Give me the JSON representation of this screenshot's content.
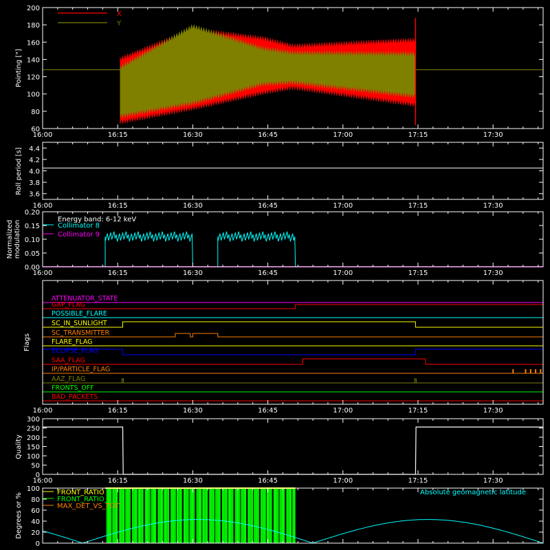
{
  "colors": {
    "background": "#000000",
    "axes": "#ffffff",
    "x": "#ff0000",
    "y": "#808000",
    "coll8": "#00ffff",
    "coll9": "#ff00ff",
    "flags": [
      "#ff00ff",
      "#ff0000",
      "#00ffff",
      "#ffff00",
      "#ff8000",
      "#ffff00",
      "#0000ff",
      "#ff0000",
      "#ff8000",
      "#808000",
      "#00ff00",
      "#ff0000"
    ],
    "front_ratio": "#ffff00",
    "front_ratio_2": "#00ff00",
    "max_det": "#ff8000",
    "geomag": "#00ffff"
  },
  "time_ticks": [
    "16:00",
    "16:15",
    "16:30",
    "16:45",
    "17:00",
    "17:15",
    "17:30"
  ],
  "chart_data": [
    {
      "id": "pointing",
      "type": "line",
      "ylabel": "Pointing [\"]",
      "ylim": [
        60,
        200
      ],
      "yticks": [
        "200",
        "180",
        "160",
        "140",
        "120",
        "100",
        "80",
        "60"
      ],
      "yvals": [
        200,
        180,
        160,
        140,
        120,
        100,
        80,
        60
      ],
      "legend": [
        "X",
        "Y"
      ],
      "x_range": [
        "16:00",
        "17:40"
      ],
      "series": [
        {
          "name": "X",
          "envelope_time": [
            "16:15.5",
            "16:30",
            "16:44",
            "16:50",
            "17:14.5"
          ],
          "upper": [
            140,
            174,
            164,
            155,
            162
          ],
          "lower": [
            68,
            84,
            102,
            108,
            88
          ]
        },
        {
          "name": "Y",
          "envelope_time": [
            "16:15.5",
            "16:30",
            "16:44",
            "16:50",
            "17:14.5"
          ],
          "upper": [
            130,
            178,
            152,
            147,
            146
          ],
          "lower": [
            75,
            90,
            112,
            114,
            98
          ]
        }
      ],
      "baseline": 128
    },
    {
      "id": "roll",
      "type": "line",
      "ylabel": "Roll period [s]",
      "ylim": [
        3.5,
        4.5
      ],
      "yticks": [
        "4.4",
        "4.2",
        "4.0",
        "3.8",
        "3.6"
      ],
      "yvals": [
        4.4,
        4.2,
        4.0,
        3.8,
        3.6
      ],
      "series": [
        {
          "value": 4.05
        }
      ]
    },
    {
      "id": "modulation",
      "type": "line",
      "ylabel_lines": [
        "Normalized",
        "modulation"
      ],
      "ylim": [
        0,
        0.2
      ],
      "yticks": [
        "0.20",
        "0.15",
        "0.10",
        "0.05",
        "0.00"
      ],
      "yvals": [
        0.2,
        0.15,
        0.1,
        0.05,
        0.0
      ],
      "legend_title": "Energy band: 6-12 keV",
      "legend": [
        "Collimator 8",
        "Collimator 9"
      ],
      "segments": [
        [
          "16:12.5",
          "16:30"
        ],
        [
          "16:35",
          "16:50.5"
        ]
      ],
      "level": 0.11
    },
    {
      "id": "flags",
      "type": "line",
      "ylabel": "Flags",
      "labels": [
        "ATTENUATOR_STATE",
        "GAP_FLAG",
        "POSSIBLE_FLARE",
        "SC_IN_SUNLIGHT",
        "SC_TRANSMITTER",
        "FLARE_FLAG",
        "ECLIPSE_FLAG",
        "SAA_FLAG",
        "IP/PARTICLE_FLAG",
        "AAZ_FLAG",
        "FRONTS_OFF",
        "BAD_PACKETS"
      ]
    },
    {
      "id": "quality",
      "type": "line",
      "ylabel": "Quality",
      "ylim": [
        0,
        300
      ],
      "yticks": [
        "300",
        "250",
        "200",
        "150",
        "100",
        "50",
        "0"
      ],
      "yvals": [
        300,
        250,
        200,
        150,
        100,
        50,
        0
      ],
      "values_time": [
        "16:00",
        "16:16",
        "16:16.1",
        "17:14.5",
        "17:14.6",
        "17:40"
      ],
      "values": [
        255,
        255,
        0,
        0,
        255,
        255
      ]
    },
    {
      "id": "ratios",
      "type": "line",
      "ylabel": "Degrees or %",
      "ylim": [
        0,
        100
      ],
      "yticks": [
        "100",
        "80",
        "60",
        "40",
        "20",
        "0"
      ],
      "yvals": [
        100,
        80,
        60,
        40,
        20,
        0
      ],
      "legend": [
        "FRONT_RATIO",
        "FRONT_RATIO_",
        "MAX_DET_VS_TOT"
      ],
      "annotation": "Absolute geomagnetic latitude",
      "green_band": [
        "16:12.5",
        "16:50.5"
      ]
    }
  ]
}
